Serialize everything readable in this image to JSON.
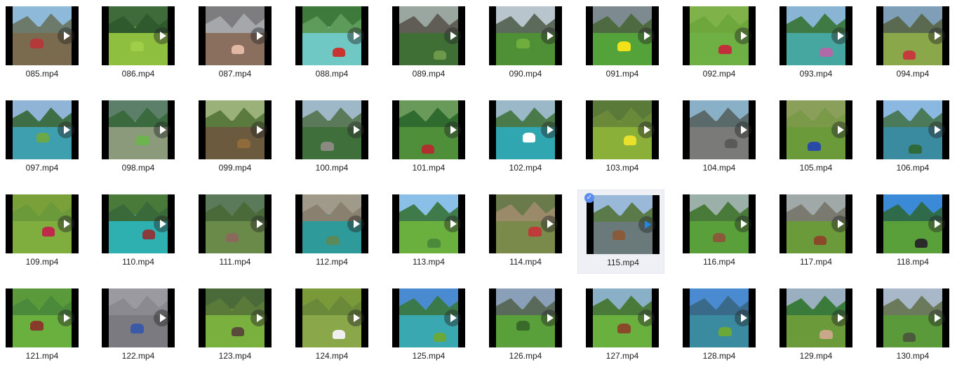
{
  "files": [
    {
      "name": "085.mp4",
      "sky": "#8fb9d8",
      "mtn": "#6b7a6a",
      "ground": "#7a6a4e",
      "accent": "#b43a3a"
    },
    {
      "name": "086.mp4",
      "sky": "#3f6a3a",
      "mtn": "#2f5a2e",
      "ground": "#8fbf3f",
      "accent": "#9fce4a"
    },
    {
      "name": "087.mp4",
      "sky": "#7d7d80",
      "mtn": "#a5a7ab",
      "ground": "#8a6e5e",
      "accent": "#e0b8a3"
    },
    {
      "name": "088.mp4",
      "sky": "#3e7a3c",
      "mtn": "#5c9b59",
      "ground": "#6fc8c4",
      "accent": "#c8342f"
    },
    {
      "name": "089.mp4",
      "sky": "#9aa7a0",
      "mtn": "#5f5d55",
      "ground": "#3f6f35",
      "accent": "#6c9a4a"
    },
    {
      "name": "090.mp4",
      "sky": "#b9c5cc",
      "mtn": "#5b6a5b",
      "ground": "#4f8f35",
      "accent": "#6fae3e"
    },
    {
      "name": "091.mp4",
      "sky": "#7d8a8f",
      "mtn": "#4e6a40",
      "ground": "#54a23a",
      "accent": "#f2e21a"
    },
    {
      "name": "092.mp4",
      "sky": "#7fb34a",
      "mtn": "#6ea83d",
      "ground": "#6eb043",
      "accent": "#c0303a"
    },
    {
      "name": "093.mp4",
      "sky": "#8ab4d4",
      "mtn": "#3f7a44",
      "ground": "#46a6a0",
      "accent": "#b06aa8"
    },
    {
      "name": "094.mp4",
      "sky": "#7f9fb8",
      "mtn": "#5a6a50",
      "ground": "#8aa84a",
      "accent": "#c53a3a"
    },
    {
      "name": "097.mp4",
      "sky": "#8fb4d6",
      "mtn": "#3e6e45",
      "ground": "#3e9fae",
      "accent": "#6aa84a"
    },
    {
      "name": "098.mp4",
      "sky": "#5c7f6a",
      "mtn": "#3a6a3e",
      "ground": "#8a9a7a",
      "accent": "#6db44e"
    },
    {
      "name": "099.mp4",
      "sky": "#9ab27a",
      "mtn": "#5b7a3e",
      "ground": "#6b5a3e",
      "accent": "#8f6a3a"
    },
    {
      "name": "100.mp4",
      "sky": "#9fb8c8",
      "mtn": "#5a7a5a",
      "ground": "#3f6f3a",
      "accent": "#8a8a80"
    },
    {
      "name": "101.mp4",
      "sky": "#6a9a5a",
      "mtn": "#2f6a2e",
      "ground": "#4f8f3a",
      "accent": "#b03030"
    },
    {
      "name": "102.mp4",
      "sky": "#9ab8c8",
      "mtn": "#4a7a4a",
      "ground": "#2fa6b0",
      "accent": "#ffffff"
    },
    {
      "name": "103.mp4",
      "sky": "#5a7a3a",
      "mtn": "#6a8a3a",
      "ground": "#8ab03a",
      "accent": "#e8e02a"
    },
    {
      "name": "104.mp4",
      "sky": "#8ab0c8",
      "mtn": "#5a6a6a",
      "ground": "#7a7a78",
      "accent": "#5a5a58"
    },
    {
      "name": "105.mp4",
      "sky": "#8aa05a",
      "mtn": "#7a9a4a",
      "ground": "#6a9a3a",
      "accent": "#2a4aa8"
    },
    {
      "name": "106.mp4",
      "sky": "#8ab8e0",
      "mtn": "#4a7a5a",
      "ground": "#3a8aa0",
      "accent": "#2f6a3a"
    },
    {
      "name": "109.mp4",
      "sky": "#7aa03a",
      "mtn": "#6a9a3a",
      "ground": "#7fae3e",
      "accent": "#c02a4a"
    },
    {
      "name": "110.mp4",
      "sky": "#4a7a3a",
      "mtn": "#3a6a3a",
      "ground": "#2fb0b0",
      "accent": "#8a3a3a"
    },
    {
      "name": "111.mp4",
      "sky": "#5a7a5a",
      "mtn": "#4a6a3a",
      "ground": "#6a8a4a",
      "accent": "#8a6a5a"
    },
    {
      "name": "112.mp4",
      "sky": "#a09a8a",
      "mtn": "#8a8070",
      "ground": "#2f9a9a",
      "accent": "#5a8a5a"
    },
    {
      "name": "113.mp4",
      "sky": "#8ac0e8",
      "mtn": "#3f7a4a",
      "ground": "#6ab03e",
      "accent": "#4a8a3a"
    },
    {
      "name": "114.mp4",
      "sky": "#6a7a4a",
      "mtn": "#9a8a6a",
      "ground": "#7a8a4a",
      "accent": "#c03a3a"
    },
    {
      "name": "115.mp4",
      "sky": "#9ab8d8",
      "mtn": "#5a7a4a",
      "ground": "#6a7a7a",
      "accent": "#8a5a3a"
    },
    {
      "name": "116.mp4",
      "sky": "#9ab0a8",
      "mtn": "#4a7a3a",
      "ground": "#5aa03a",
      "accent": "#8a5a3a"
    },
    {
      "name": "117.mp4",
      "sky": "#a0a8a8",
      "mtn": "#7a7a70",
      "ground": "#6a9a3a",
      "accent": "#8a4a2a"
    },
    {
      "name": "118.mp4",
      "sky": "#3a8ad8",
      "mtn": "#2f6a4a",
      "ground": "#5aa03a",
      "accent": "#2a2a2a"
    },
    {
      "name": "121.mp4",
      "sky": "#5a9a3a",
      "mtn": "#4a8a3a",
      "ground": "#6ab03e",
      "accent": "#8a3a2a"
    },
    {
      "name": "122.mp4",
      "sky": "#9a9aa0",
      "mtn": "#8a8a90",
      "ground": "#7a7a80",
      "accent": "#3a5aa8"
    },
    {
      "name": "123.mp4",
      "sky": "#4a6a3a",
      "mtn": "#5a7a3a",
      "ground": "#7ab03e",
      "accent": "#5a4a3a"
    },
    {
      "name": "124.mp4",
      "sky": "#7a9a3a",
      "mtn": "#6a8a3a",
      "ground": "#8aa84a",
      "accent": "#f0f0f0"
    },
    {
      "name": "125.mp4",
      "sky": "#4a8ad0",
      "mtn": "#3a7a4a",
      "ground": "#3aa8b0",
      "accent": "#6aa83a"
    },
    {
      "name": "126.mp4",
      "sky": "#8aa0b8",
      "mtn": "#5a6a5a",
      "ground": "#5aa03a",
      "accent": "#3a6a2a"
    },
    {
      "name": "127.mp4",
      "sky": "#8ab0c8",
      "mtn": "#4a7a3a",
      "ground": "#6ab03e",
      "accent": "#8a4a2a"
    },
    {
      "name": "128.mp4",
      "sky": "#4a8ad0",
      "mtn": "#3a6a8a",
      "ground": "#3a8aa0",
      "accent": "#6aa83a"
    },
    {
      "name": "129.mp4",
      "sky": "#9ab0c0",
      "mtn": "#3a7a3a",
      "ground": "#6a9a3a",
      "accent": "#c8a888"
    },
    {
      "name": "130.mp4",
      "sky": "#a8b8c8",
      "mtn": "#6a7a5a",
      "ground": "#5a9a3a",
      "accent": "#4a5a3a"
    }
  ]
}
